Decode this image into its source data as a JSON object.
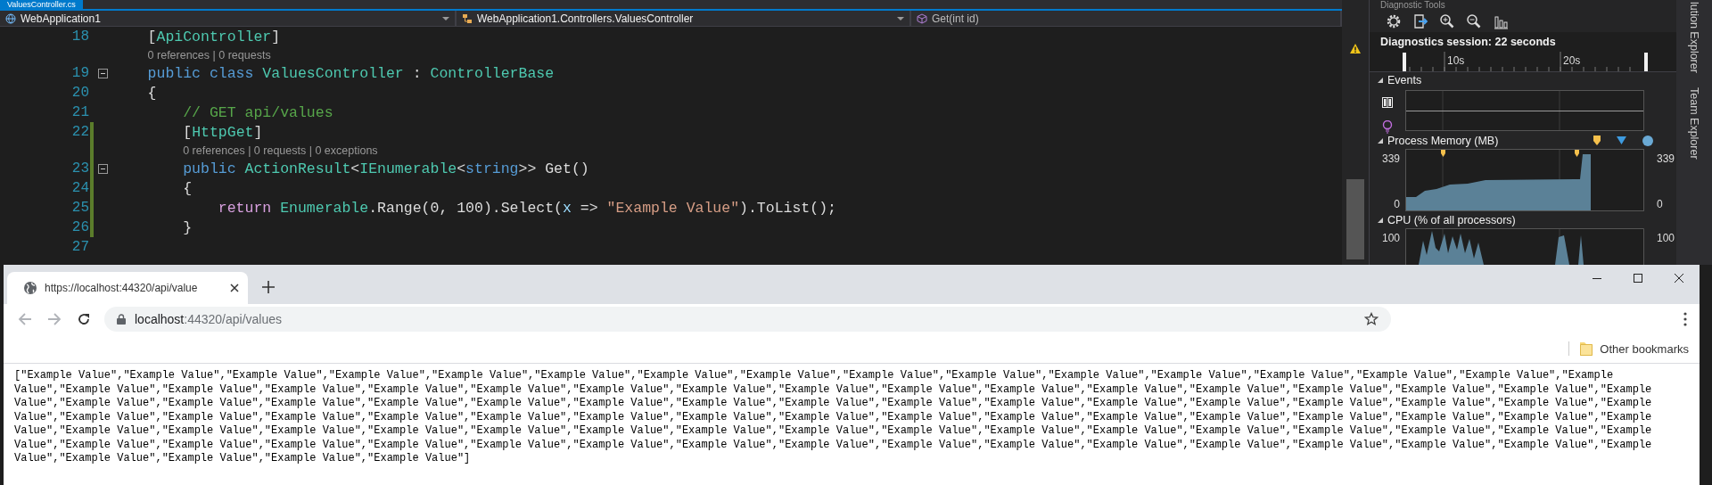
{
  "editor": {
    "tab": {
      "title": "ValuesController.cs",
      "selected": true
    },
    "navigation": [
      {
        "text": "WebApplication1",
        "kind": "project"
      },
      {
        "text": "WebApplication1.Controllers.ValuesController",
        "kind": "class"
      },
      {
        "text": "Get(int id)",
        "kind": "method"
      }
    ],
    "lines": [
      {
        "kind": "code",
        "number": "18",
        "changed": false,
        "tokens": [
          {
            "text": "    [",
            "kind": "plain"
          },
          {
            "text": "ApiController",
            "kind": "type"
          },
          {
            "text": "]",
            "kind": "plain"
          }
        ]
      },
      {
        "kind": "codelens",
        "text": "0 references | 0 requests"
      },
      {
        "kind": "code",
        "number": "19",
        "changed": false,
        "collapsible": true,
        "expanded": true,
        "tokens": [
          {
            "text": "    public class ",
            "kind": "keyword"
          },
          {
            "text": "ValuesController",
            "kind": "type"
          },
          {
            "text": " : ",
            "kind": "plain"
          },
          {
            "text": "ControllerBase",
            "kind": "type"
          }
        ]
      },
      {
        "kind": "code",
        "number": "20",
        "changed": false,
        "tokens": [
          {
            "text": "    {",
            "kind": "plain"
          }
        ]
      },
      {
        "kind": "code",
        "number": "21",
        "changed": false,
        "tokens": [
          {
            "text": "        // GET api/values",
            "kind": "comment"
          }
        ]
      },
      {
        "kind": "code",
        "number": "22",
        "changed": true,
        "tokens": [
          {
            "text": "        [",
            "kind": "plain"
          },
          {
            "text": "HttpGet",
            "kind": "type"
          },
          {
            "text": "]",
            "kind": "plain"
          }
        ]
      },
      {
        "kind": "codelens",
        "text": "0 references | 0 requests | 0 exceptions"
      },
      {
        "kind": "code",
        "number": "23",
        "changed": true,
        "collapsible": true,
        "expanded": true,
        "tokens": [
          {
            "text": "        public ",
            "kind": "keyword"
          },
          {
            "text": "ActionResult",
            "kind": "type"
          },
          {
            "text": "<",
            "kind": "plain"
          },
          {
            "text": "IEnumerable",
            "kind": "type"
          },
          {
            "text": "<",
            "kind": "plain"
          },
          {
            "text": "string",
            "kind": "keyword"
          },
          {
            "text": ">> Get()",
            "kind": "plain"
          }
        ]
      },
      {
        "kind": "code",
        "number": "24",
        "changed": true,
        "tokens": [
          {
            "text": "        {",
            "kind": "plain"
          }
        ]
      },
      {
        "kind": "code",
        "number": "25",
        "changed": true,
        "tokens": [
          {
            "text": "            return ",
            "kind": "control"
          },
          {
            "text": "Enumerable",
            "kind": "type"
          },
          {
            "text": ".Range(0, 100).Select(",
            "kind": "plain"
          },
          {
            "text": "x",
            "kind": "parameter"
          },
          {
            "text": " => ",
            "kind": "plain"
          },
          {
            "text": "\"Example Value\"",
            "kind": "string"
          },
          {
            "text": ").ToList();",
            "kind": "plain"
          }
        ]
      },
      {
        "kind": "code",
        "number": "26",
        "changed": true,
        "tokens": [
          {
            "text": "        }",
            "kind": "plain"
          }
        ]
      },
      {
        "kind": "code",
        "number": "27",
        "changed": false
      }
    ]
  },
  "diagnostics": {
    "title": "Diagnostic Tools",
    "session": "Diagnostics session: 22 seconds",
    "ruler_ticks": [
      "10s",
      "20s"
    ],
    "sections": [
      {
        "kind": "events",
        "title": "Events",
        "expanded": true
      },
      {
        "kind": "memory",
        "title": "Process Memory (MB)",
        "expanded": true,
        "left_axis": [
          "339",
          "0"
        ],
        "right_axis": [
          "339",
          "0"
        ]
      },
      {
        "kind": "cpu",
        "title": "CPU (% of all processors)",
        "expanded": true,
        "left_axis": [
          "100"
        ],
        "right_axis": [
          "100"
        ]
      }
    ]
  },
  "side_tabs": [
    "lution Explorer",
    "Team Explorer"
  ],
  "browser": {
    "tab": {
      "title": "https://localhost:44320/api/value",
      "selected": true
    },
    "back": {
      "disabled": true
    },
    "forward": {
      "disabled": true
    },
    "address": {
      "host": "localhost",
      "path": ":44320/api/values"
    },
    "bookmarks": [
      "Other bookmarks"
    ],
    "body": "[\"Example Value\",\"Example Value\",\"Example Value\",\"Example Value\",\"Example Value\",\"Example Value\",\"Example Value\",\"Example Value\",\"Example Value\",\"Example Value\",\"Example Value\",\"Example Value\",\"Example Value\",\"Example Value\",\"Example Value\",\"Example Value\",\"Example Value\",\"Example Value\",\"Example Value\",\"Example Value\",\"Example Value\",\"Example Value\",\"Example Value\",\"Example Value\",\"Example Value\",\"Example Value\",\"Example Value\",\"Example Value\",\"Example Value\",\"Example Value\",\"Example Value\",\"Example Value\",\"Example Value\",\"Example Value\",\"Example Value\",\"Example Value\",\"Example Value\",\"Example Value\",\"Example Value\",\"Example Value\",\"Example Value\",\"Example Value\",\"Example Value\",\"Example Value\",\"Example Value\",\"Example Value\",\"Example Value\",\"Example Value\",\"Example Value\",\"Example Value\",\"Example Value\",\"Example Value\",\"Example Value\",\"Example Value\",\"Example Value\",\"Example Value\",\"Example Value\",\"Example Value\",\"Example Value\",\"Example Value\",\"Example Value\",\"Example Value\",\"Example Value\",\"Example Value\",\"Example Value\",\"Example Value\",\"Example Value\",\"Example Value\",\"Example Value\",\"Example Value\",\"Example Value\",\"Example Value\",\"Example Value\",\"Example Value\",\"Example Value\",\"Example Value\",\"Example Value\",\"Example Value\",\"Example Value\",\"Example Value\",\"Example Value\",\"Example Value\",\"Example Value\",\"Example Value\",\"Example Value\",\"Example Value\",\"Example Value\",\"Example Value\",\"Example Value\",\"Example Value\",\"Example Value\",\"Example Value\",\"Example Value\",\"Example Value\",\"Example Value\",\"Example Value\",\"Example Value\",\"Example Value\",\"Example Value\",\"Example Value\"]"
  }
}
